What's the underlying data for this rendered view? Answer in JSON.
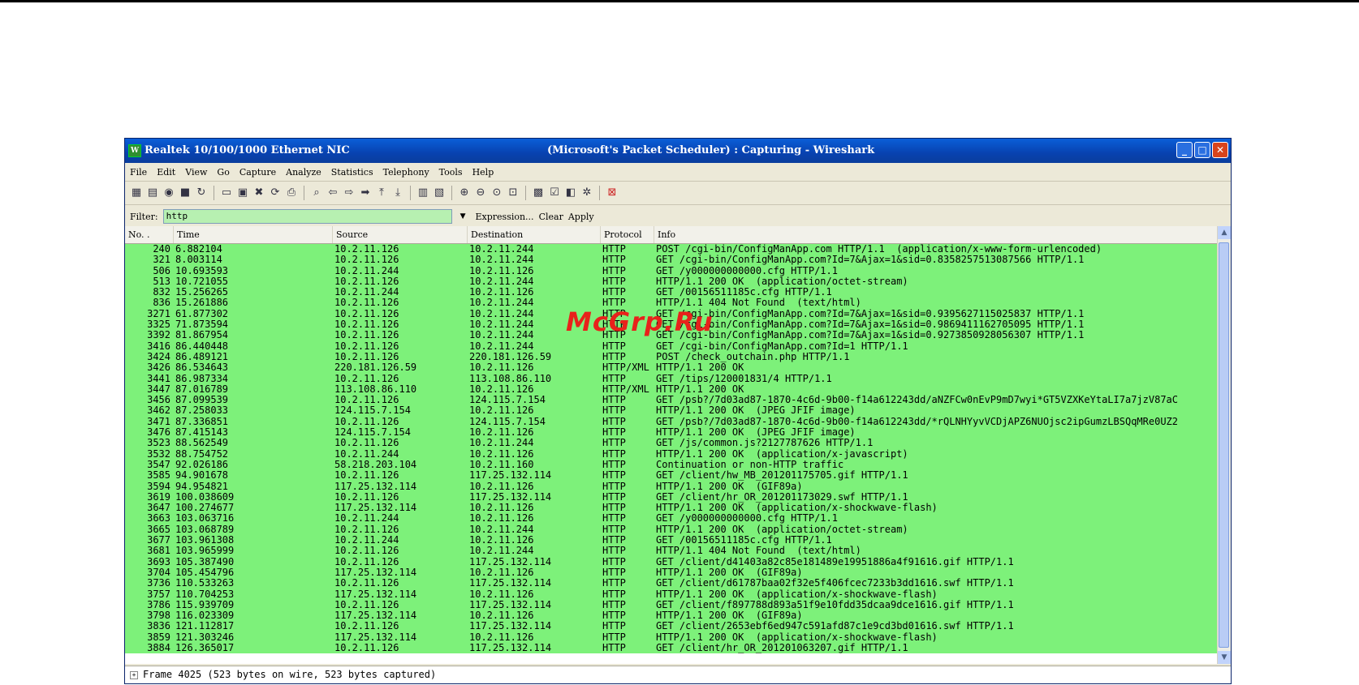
{
  "window": {
    "title_left": "Realtek 10/100/1000 Ethernet NIC",
    "title_center": "(Microsoft's Packet Scheduler) : Capturing - Wireshark",
    "buttons": {
      "minimize": "_",
      "maximize": "□",
      "close": "✕"
    }
  },
  "menu": [
    "File",
    "Edit",
    "View",
    "Go",
    "Capture",
    "Analyze",
    "Statistics",
    "Telephony",
    "Tools",
    "Help"
  ],
  "filter": {
    "label": "Filter:",
    "value": "http",
    "expression": "Expression...",
    "clear": "Clear",
    "apply": "Apply"
  },
  "columns": [
    "No. .",
    "Time",
    "Source",
    "Destination",
    "Protocol",
    "Info"
  ],
  "packets": [
    {
      "no": "240",
      "time": "6.882104",
      "src": "10.2.11.126",
      "dst": "10.2.11.244",
      "proto": "HTTP",
      "info": "POST /cgi-bin/ConfigManApp.com HTTP/1.1  (application/x-www-form-urlencoded)"
    },
    {
      "no": "321",
      "time": "8.003114",
      "src": "10.2.11.126",
      "dst": "10.2.11.244",
      "proto": "HTTP",
      "info": "GET /cgi-bin/ConfigManApp.com?Id=7&Ajax=1&sid=0.8358257513087566 HTTP/1.1"
    },
    {
      "no": "506",
      "time": "10.693593",
      "src": "10.2.11.244",
      "dst": "10.2.11.126",
      "proto": "HTTP",
      "info": "GET /y000000000000.cfg HTTP/1.1"
    },
    {
      "no": "513",
      "time": "10.721055",
      "src": "10.2.11.126",
      "dst": "10.2.11.244",
      "proto": "HTTP",
      "info": "HTTP/1.1 200 OK  (application/octet-stream)"
    },
    {
      "no": "832",
      "time": "15.256265",
      "src": "10.2.11.244",
      "dst": "10.2.11.126",
      "proto": "HTTP",
      "info": "GET /00156511185c.cfg HTTP/1.1"
    },
    {
      "no": "836",
      "time": "15.261886",
      "src": "10.2.11.126",
      "dst": "10.2.11.244",
      "proto": "HTTP",
      "info": "HTTP/1.1 404 Not Found  (text/html)"
    },
    {
      "no": "3271",
      "time": "61.877302",
      "src": "10.2.11.126",
      "dst": "10.2.11.244",
      "proto": "HTTP",
      "info": "GET /cgi-bin/ConfigManApp.com?Id=7&Ajax=1&sid=0.9395627115025837 HTTP/1.1"
    },
    {
      "no": "3325",
      "time": "71.873594",
      "src": "10.2.11.126",
      "dst": "10.2.11.244",
      "proto": "HTTP",
      "info": "GET /cgi-bin/ConfigManApp.com?Id=7&Ajax=1&sid=0.9869411162705095 HTTP/1.1"
    },
    {
      "no": "3392",
      "time": "81.867954",
      "src": "10.2.11.126",
      "dst": "10.2.11.244",
      "proto": "HTTP",
      "info": "GET /cgi-bin/ConfigManApp.com?Id=7&Ajax=1&sid=0.9273850928056307 HTTP/1.1"
    },
    {
      "no": "3416",
      "time": "86.440448",
      "src": "10.2.11.126",
      "dst": "10.2.11.244",
      "proto": "HTTP",
      "info": "GET /cgi-bin/ConfigManApp.com?Id=1 HTTP/1.1"
    },
    {
      "no": "3424",
      "time": "86.489121",
      "src": "10.2.11.126",
      "dst": "220.181.126.59",
      "proto": "HTTP",
      "info": "POST /check_outchain.php HTTP/1.1"
    },
    {
      "no": "3426",
      "time": "86.534643",
      "src": "220.181.126.59",
      "dst": "10.2.11.126",
      "proto": "HTTP/XML",
      "info": "HTTP/1.1 200 OK"
    },
    {
      "no": "3441",
      "time": "86.987334",
      "src": "10.2.11.126",
      "dst": "113.108.86.110",
      "proto": "HTTP",
      "info": "GET /tips/120001831/4 HTTP/1.1"
    },
    {
      "no": "3447",
      "time": "87.016789",
      "src": "113.108.86.110",
      "dst": "10.2.11.126",
      "proto": "HTTP/XML",
      "info": "HTTP/1.1 200 OK"
    },
    {
      "no": "3456",
      "time": "87.099539",
      "src": "10.2.11.126",
      "dst": "124.115.7.154",
      "proto": "HTTP",
      "info": "GET /psb?/7d03ad87-1870-4c6d-9b00-f14a612243dd/aNZFCw0nEvP9mD7wyi*GT5VZXKeYtaLI7a7jzV87aC"
    },
    {
      "no": "3462",
      "time": "87.258033",
      "src": "124.115.7.154",
      "dst": "10.2.11.126",
      "proto": "HTTP",
      "info": "HTTP/1.1 200 OK  (JPEG JFIF image)"
    },
    {
      "no": "3471",
      "time": "87.336851",
      "src": "10.2.11.126",
      "dst": "124.115.7.154",
      "proto": "HTTP",
      "info": "GET /psb?/7d03ad87-1870-4c6d-9b00-f14a612243dd/*rQLNHYyvVCDjAPZ6NUOjsc2ipGumzLBSQqMRe0UZ2"
    },
    {
      "no": "3476",
      "time": "87.415143",
      "src": "124.115.7.154",
      "dst": "10.2.11.126",
      "proto": "HTTP",
      "info": "HTTP/1.1 200 OK  (JPEG JFIF image)"
    },
    {
      "no": "3523",
      "time": "88.562549",
      "src": "10.2.11.126",
      "dst": "10.2.11.244",
      "proto": "HTTP",
      "info": "GET /js/common.js?2127787626 HTTP/1.1"
    },
    {
      "no": "3532",
      "time": "88.754752",
      "src": "10.2.11.244",
      "dst": "10.2.11.126",
      "proto": "HTTP",
      "info": "HTTP/1.1 200 OK  (application/x-javascript)"
    },
    {
      "no": "3547",
      "time": "92.026186",
      "src": "58.218.203.104",
      "dst": "10.2.11.160",
      "proto": "HTTP",
      "info": "Continuation or non-HTTP traffic"
    },
    {
      "no": "3585",
      "time": "94.901678",
      "src": "10.2.11.126",
      "dst": "117.25.132.114",
      "proto": "HTTP",
      "info": "GET /client/hw_MB_201201175705.gif HTTP/1.1"
    },
    {
      "no": "3594",
      "time": "94.954821",
      "src": "117.25.132.114",
      "dst": "10.2.11.126",
      "proto": "HTTP",
      "info": "HTTP/1.1 200 OK  (GIF89a)"
    },
    {
      "no": "3619",
      "time": "100.038609",
      "src": "10.2.11.126",
      "dst": "117.25.132.114",
      "proto": "HTTP",
      "info": "GET /client/hr_OR_201201173029.swf HTTP/1.1"
    },
    {
      "no": "3647",
      "time": "100.274677",
      "src": "117.25.132.114",
      "dst": "10.2.11.126",
      "proto": "HTTP",
      "info": "HTTP/1.1 200 OK  (application/x-shockwave-flash)"
    },
    {
      "no": "3663",
      "time": "103.063716",
      "src": "10.2.11.244",
      "dst": "10.2.11.126",
      "proto": "HTTP",
      "info": "GET /y000000000000.cfg HTTP/1.1"
    },
    {
      "no": "3665",
      "time": "103.068789",
      "src": "10.2.11.126",
      "dst": "10.2.11.244",
      "proto": "HTTP",
      "info": "HTTP/1.1 200 OK  (application/octet-stream)"
    },
    {
      "no": "3677",
      "time": "103.961308",
      "src": "10.2.11.244",
      "dst": "10.2.11.126",
      "proto": "HTTP",
      "info": "GET /00156511185c.cfg HTTP/1.1"
    },
    {
      "no": "3681",
      "time": "103.965999",
      "src": "10.2.11.126",
      "dst": "10.2.11.244",
      "proto": "HTTP",
      "info": "HTTP/1.1 404 Not Found  (text/html)"
    },
    {
      "no": "3693",
      "time": "105.387490",
      "src": "10.2.11.126",
      "dst": "117.25.132.114",
      "proto": "HTTP",
      "info": "GET /client/d41403a82c85e181489e19951886a4f91616.gif HTTP/1.1"
    },
    {
      "no": "3704",
      "time": "105.454796",
      "src": "117.25.132.114",
      "dst": "10.2.11.126",
      "proto": "HTTP",
      "info": "HTTP/1.1 200 OK  (GIF89a)"
    },
    {
      "no": "3736",
      "time": "110.533263",
      "src": "10.2.11.126",
      "dst": "117.25.132.114",
      "proto": "HTTP",
      "info": "GET /client/d61787baa02f32e5f406fcec7233b3dd1616.swf HTTP/1.1"
    },
    {
      "no": "3757",
      "time": "110.704253",
      "src": "117.25.132.114",
      "dst": "10.2.11.126",
      "proto": "HTTP",
      "info": "HTTP/1.1 200 OK  (application/x-shockwave-flash)"
    },
    {
      "no": "3786",
      "time": "115.939709",
      "src": "10.2.11.126",
      "dst": "117.25.132.114",
      "proto": "HTTP",
      "info": "GET /client/f897788d893a51f9e10fdd35dcaa9dce1616.gif HTTP/1.1"
    },
    {
      "no": "3798",
      "time": "116.023309",
      "src": "117.25.132.114",
      "dst": "10.2.11.126",
      "proto": "HTTP",
      "info": "HTTP/1.1 200 OK  (GIF89a)"
    },
    {
      "no": "3836",
      "time": "121.112817",
      "src": "10.2.11.126",
      "dst": "117.25.132.114",
      "proto": "HTTP",
      "info": "GET /client/2653ebf6ed947c591afd87c1e9cd3bd01616.swf HTTP/1.1"
    },
    {
      "no": "3859",
      "time": "121.303246",
      "src": "117.25.132.114",
      "dst": "10.2.11.126",
      "proto": "HTTP",
      "info": "HTTP/1.1 200 OK  (application/x-shockwave-flash)"
    },
    {
      "no": "3884",
      "time": "126.365017",
      "src": "10.2.11.126",
      "dst": "117.25.132.114",
      "proto": "HTTP",
      "info": "GET /client/hr_OR_201201063207.gif HTTP/1.1"
    }
  ],
  "detail": {
    "frame_text": "Frame 4025 (523 bytes on wire, 523 bytes captured)"
  },
  "watermark": "McGrp.Ru",
  "colors": {
    "row_bg": "#7df17a",
    "filter_bg": "#b7f0b1",
    "titlebar": "#0842b0"
  }
}
